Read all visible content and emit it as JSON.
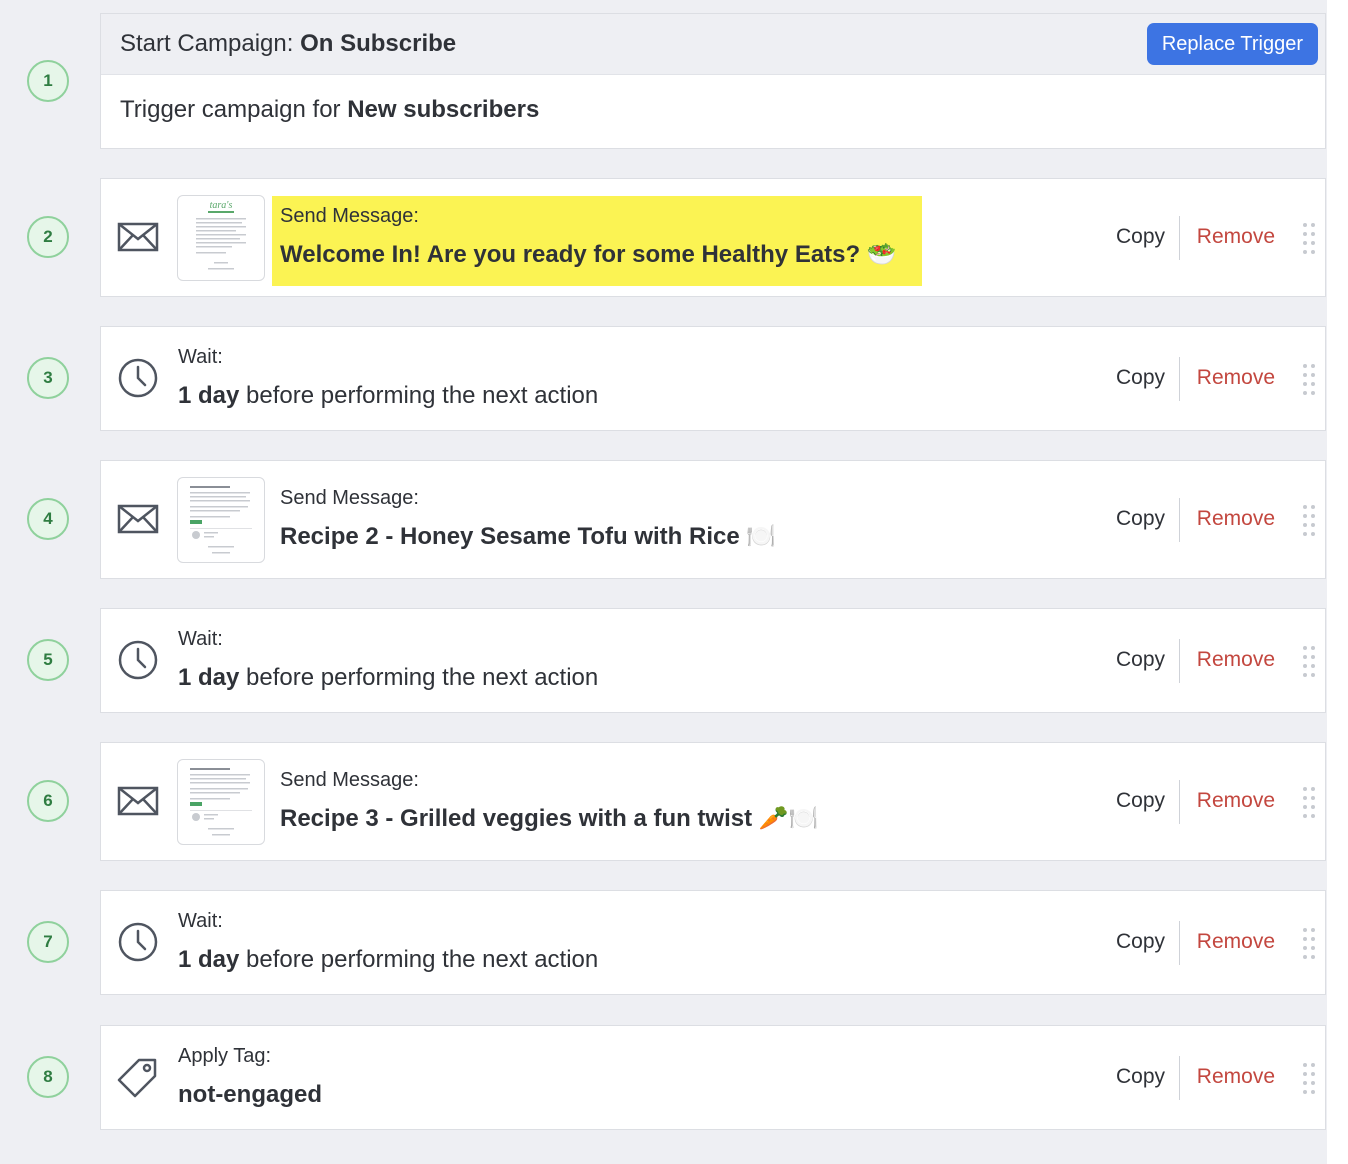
{
  "trigger": {
    "step": "1",
    "title_prefix": "Start Campaign: ",
    "title_value": "On Subscribe",
    "replace_label": "Replace Trigger",
    "body_prefix": "Trigger campaign for ",
    "body_value": "New subscribers"
  },
  "steps": [
    {
      "step": "2",
      "type": "message",
      "label": "Send Message:",
      "title": "Welcome In! Are you ready for some Healthy Eats? 🥗",
      "highlighted": true,
      "thumb_icon": "newsletter-thumbnail-taras"
    },
    {
      "step": "3",
      "type": "wait",
      "label": "Wait:",
      "amount": "1 day",
      "rest": " before performing the next action"
    },
    {
      "step": "4",
      "type": "message",
      "label": "Send Message:",
      "title": "Recipe 2 - Honey Sesame Tofu with Rice 🍽️",
      "thumb_icon": "newsletter-thumbnail"
    },
    {
      "step": "5",
      "type": "wait",
      "label": "Wait:",
      "amount": "1 day",
      "rest": " before performing the next action"
    },
    {
      "step": "6",
      "type": "message",
      "label": "Send Message:",
      "title": "Recipe 3 - Grilled veggies with a fun twist 🥕🍽️",
      "thumb_icon": "newsletter-thumbnail"
    },
    {
      "step": "7",
      "type": "wait",
      "label": "Wait:",
      "amount": "1 day",
      "rest": " before performing the next action"
    },
    {
      "step": "8",
      "type": "tag",
      "label": "Apply Tag:",
      "tag": "not-engaged"
    }
  ],
  "actions": {
    "copy": "Copy",
    "remove": "Remove"
  },
  "colors": {
    "accent": "#3d74e3",
    "remove": "#c3473f",
    "step_badge_bg": "#e6f6e9",
    "step_badge_border": "#8fd19c",
    "highlight": "#fbf353"
  }
}
